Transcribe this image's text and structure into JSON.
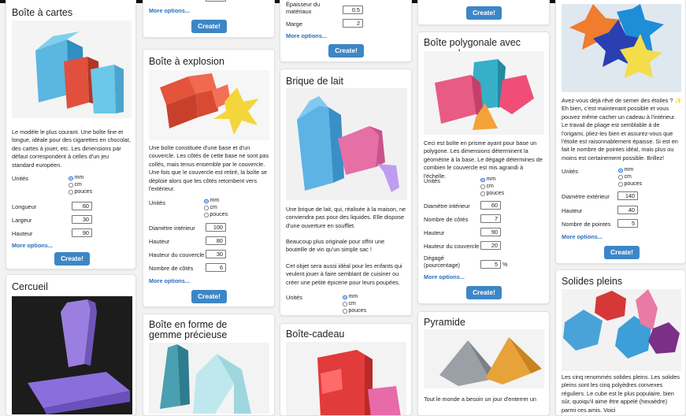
{
  "colors": {
    "accent": "#3d86c6",
    "link": "#2a6ebb"
  },
  "cards": {
    "boite_a_cartes": {
      "title": "Boîte à cartes",
      "description": "Le modèle le plus courant. Une boîte fine et longue, idéale pour des cigarettes en chocolat, des cartes à jouer, etc. Les dimensions par défaut correspondent à celles d'un jeu standard européen.",
      "units_label": "Unités",
      "units": [
        "mm",
        "cm",
        "pouces"
      ],
      "selected_unit": "mm",
      "fields": [
        {
          "label": "Longueur",
          "value": "60"
        },
        {
          "label": "Largeur",
          "value": "30"
        },
        {
          "label": "Hauteur",
          "value": "90"
        }
      ],
      "more": "More options...",
      "create": "Create!"
    },
    "cercueil": {
      "title": "Cercueil"
    },
    "col2_top": {
      "more": "More options...",
      "create": "Create!"
    },
    "boite_explosion": {
      "title": "Boîte à explosion",
      "description": "Une boîte constituée d'une base et d'un couvercle. Les côtés de cette base ne sont pas collés, mais tenus ensemble par le couvercle. Une fois que le couvercle est retiré, la boîte se déploie alors que les côtés retombent vers l'extérieur.",
      "units_label": "Unités",
      "units": [
        "mm",
        "cm",
        "pouces"
      ],
      "selected_unit": "mm",
      "fields": [
        {
          "label": "Diamètre intérieur",
          "value": "100"
        },
        {
          "label": "Hauteur",
          "value": "80"
        },
        {
          "label": "Hauteur du couvercle",
          "value": "30"
        },
        {
          "label": "Nombre de côtés",
          "value": "6"
        }
      ],
      "more": "More options...",
      "create": "Create!"
    },
    "gemme": {
      "title": "Boîte en forme de gemme précieuse"
    },
    "col3_top": {
      "fields": [
        {
          "label": "Épaisseur du matériaux",
          "value": "0.5"
        },
        {
          "label": "Marge",
          "value": "2"
        }
      ],
      "more": "More options...",
      "create": "Create!"
    },
    "brique": {
      "title": "Brique de lait",
      "description1": "Une brique de lait, qui, réalisée à la maison, ne conviendra pas pour des liquides. Elle dispose d'une ouverture en soufflet.",
      "description2": "Beaucoup plus originale pour offrir une bouteille de vin qu'un simple sac !",
      "description3": "Cet objet sera aussi idéal pour les enfants qui veulent jouer à faire semblant de cuisiner ou créer une petite épicerie pour leurs poupées.",
      "units_label": "Unités",
      "units": [
        "mm",
        "cm",
        "pouces"
      ],
      "selected_unit": "mm"
    },
    "cadeau": {
      "title": "Boîte-cadeau"
    },
    "col4_top": {
      "create": "Create!"
    },
    "polygonale": {
      "title": "Boîte polygonale avec couvercle",
      "description": "Ceci est boîte en prisme ayant pour base un polygone. Les dimensions déterminent la géométrie à la base. Le dégagé détermines de combien le couvercle est mis agrandi à l'échelle.",
      "units_label": "Unités",
      "units": [
        "mm",
        "cm",
        "pouces"
      ],
      "selected_unit": "mm",
      "fields": [
        {
          "label": "Diamètre intérieur",
          "value": "60"
        },
        {
          "label": "Nombre de côtés",
          "value": "7"
        },
        {
          "label": "Hauteur",
          "value": "90"
        },
        {
          "label": "Hauteur du couvercle",
          "value": "20"
        },
        {
          "label": "Dégagé (pourcentage)",
          "value": "5"
        }
      ],
      "percent": "%",
      "more": "More options...",
      "create": "Create!"
    },
    "pyramide": {
      "title": "Pyramide",
      "description": "Tout le monde a besoin un jour d'enterrer un"
    },
    "etoile": {
      "description": "Avez-vous déjà rêvé de semer des étoiles ? ✨ Eh bien, c'est maintenant possible et vous pouvez même cacher un cadeau à l'intérieur. Le travail de pliage est semblable à de l'origami, pliez-les bien et assurez-vous que l'étoile est raisonnablement épaisse. Si est en fait le nombre de pointes idéal, mais plus ou moins est certainement possible. Brillez!",
      "units_label": "Unités",
      "units": [
        "mm",
        "cm",
        "pouces"
      ],
      "selected_unit": "mm",
      "fields": [
        {
          "label": "Diamètre extérieur",
          "value": "140"
        },
        {
          "label": "Hauteur",
          "value": "40"
        },
        {
          "label": "Nombre de pointes",
          "value": "5"
        }
      ],
      "more": "More options...",
      "create": "Create!"
    },
    "solides": {
      "title": "Solides pleins",
      "description": "Les cinq renommés solides pleins. Les solides pleins sont les cinq polyèdres convexes réguliers. Le cube est le plus populaire, bien sûr, quoiqu'il aime être appelé (hexaèdre) parmi ces amis. Voici"
    }
  }
}
